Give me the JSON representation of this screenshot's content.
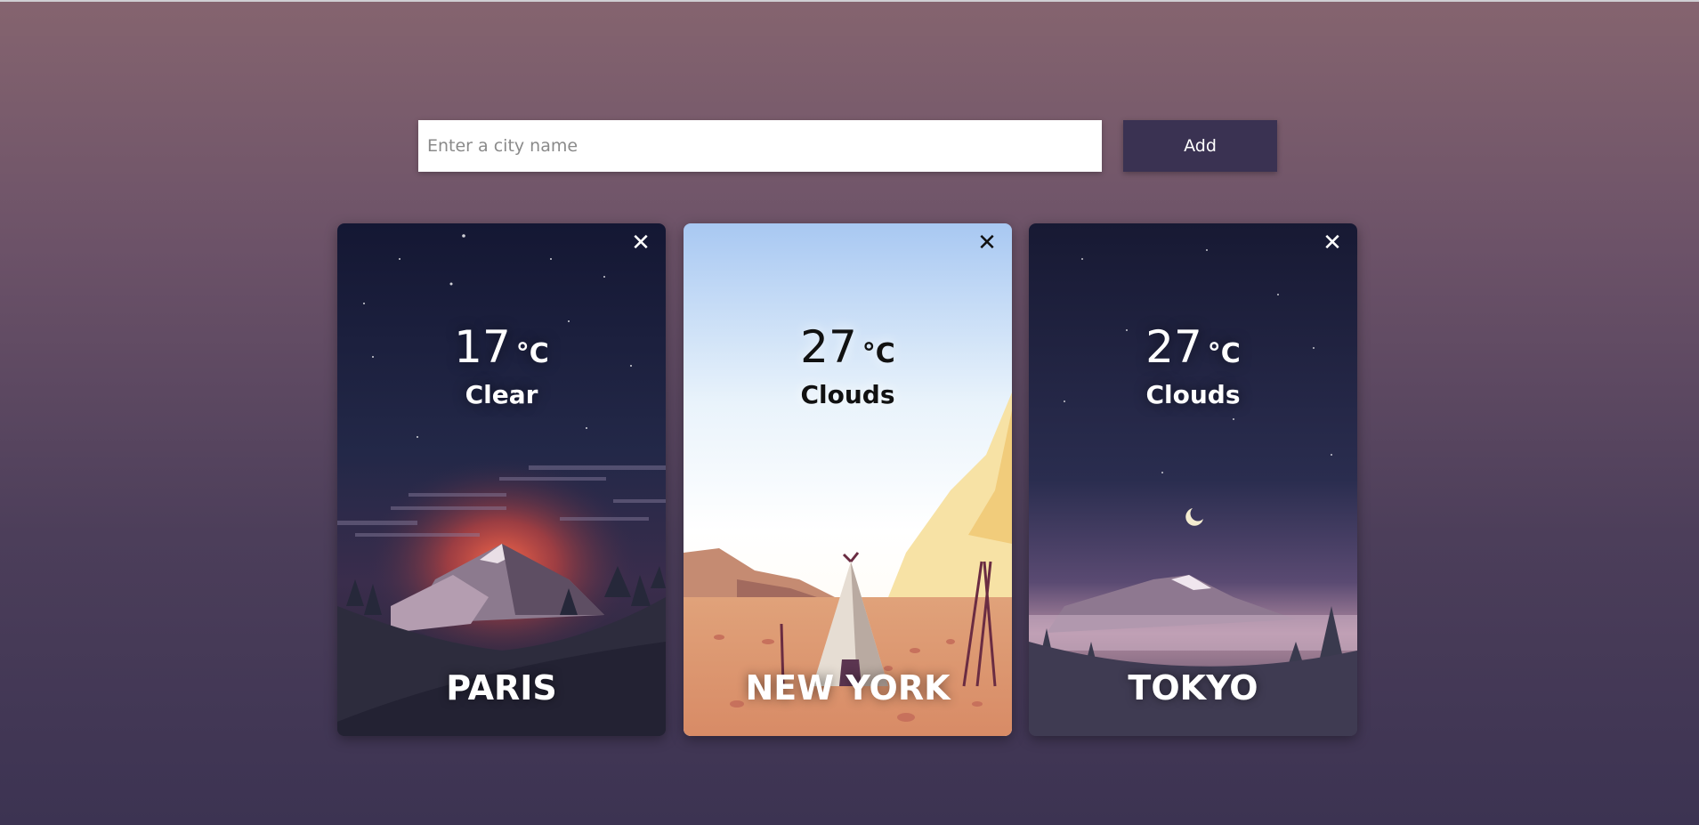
{
  "search": {
    "placeholder": "Enter a city name",
    "value": "",
    "add_label": "Add"
  },
  "cards": [
    {
      "city": "PARIS",
      "temp": "17",
      "unit": "°C",
      "condition": "Clear",
      "close": "✕",
      "scene": "night-mountain-sunset"
    },
    {
      "city": "NEW YORK",
      "temp": "27",
      "unit": "°C",
      "condition": "Clouds",
      "close": "✕",
      "scene": "desert-teepee-day"
    },
    {
      "city": "TOKYO",
      "temp": "27",
      "unit": "°C",
      "condition": "Clouds",
      "close": "✕",
      "scene": "night-mountain-moon"
    }
  ],
  "colors": {
    "button_bg": "#3a3252",
    "page_top": "#85646f",
    "page_bottom": "#3c3352"
  }
}
